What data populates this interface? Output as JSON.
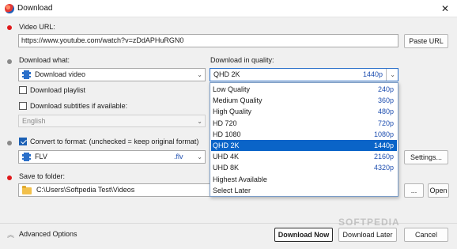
{
  "window": {
    "title": "Download",
    "close_glyph": "✕"
  },
  "video_url": {
    "label": "Video URL:",
    "value": "https://www.youtube.com/watch?v=zDdAPHuRGN0",
    "paste_button": "Paste URL"
  },
  "download_what": {
    "label": "Download what:",
    "selected": "Download video",
    "playlist_label": "Download playlist",
    "subtitles_label": "Download subtitles if available:",
    "subtitles_language": "English"
  },
  "quality": {
    "label": "Download in quality:",
    "selected_name": "QHD 2K",
    "selected_value": "1440p",
    "options": [
      {
        "name": "Low Quality",
        "value": "240p"
      },
      {
        "name": "Medium Quality",
        "value": "360p"
      },
      {
        "name": "High Quality",
        "value": "480p"
      },
      {
        "name": "HD 720",
        "value": "720p"
      },
      {
        "name": "HD 1080",
        "value": "1080p"
      },
      {
        "name": "QHD 2K",
        "value": "1440p"
      },
      {
        "name": "UHD 4K",
        "value": "2160p"
      },
      {
        "name": "UHD 8K",
        "value": "4320p"
      },
      {
        "name": "Highest Available",
        "value": ""
      },
      {
        "name": "Select Later",
        "value": ""
      }
    ],
    "selected_index": 5
  },
  "convert": {
    "label": "Convert to format: (unchecked = keep original format)",
    "format": "FLV",
    "extension": ".flv",
    "settings_button": "Settings..."
  },
  "save": {
    "label": "Save to folder:",
    "path": "C:\\Users\\Softpedia Test\\Videos",
    "browse_button": "...",
    "open_button": "Open"
  },
  "footer": {
    "advanced": "Advanced Options",
    "download_now": "Download Now",
    "download_later": "Download Later",
    "cancel": "Cancel"
  },
  "watermark": "SOFTPEDIA",
  "colors": {
    "accent": "#0a64c8",
    "required_dot": "#e0191b",
    "value_text": "#1f4fb0"
  }
}
